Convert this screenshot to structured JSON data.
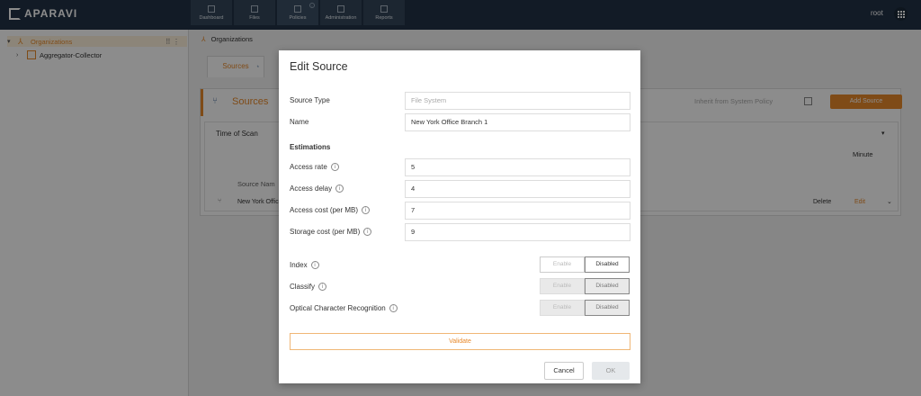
{
  "app": {
    "logo": "APARAVI",
    "user": "root"
  },
  "nav": [
    {
      "label": "Dashboard",
      "icon": "dashboard-icon"
    },
    {
      "label": "Files",
      "icon": "folder-icon"
    },
    {
      "label": "Policies",
      "icon": "gear-icon"
    },
    {
      "label": "Administration",
      "icon": "users-icon"
    },
    {
      "label": "Reports",
      "icon": "report-icon"
    }
  ],
  "sidebar": {
    "items": [
      {
        "label": "Organizations"
      },
      {
        "label": "Aggregator-Collector"
      }
    ]
  },
  "breadcrumb": {
    "label": "Organizations"
  },
  "tab": {
    "label": "Sources",
    "marker": "*"
  },
  "panel": {
    "title": "Sources",
    "inherit_label": "Inherit from System Policy",
    "add_label": "Add Source",
    "time_of_scan": "Time of Scan",
    "minute": "Minute",
    "column_header": "Source Nam",
    "row": {
      "name": "New York Offic",
      "delete": "Delete",
      "edit": "Edit"
    }
  },
  "modal": {
    "title": "Edit Source",
    "source_type_label": "Source Type",
    "source_type_value": "File System",
    "name_label": "Name",
    "name_value": "New York Office Branch 1",
    "estimations_label": "Estimations",
    "access_rate_label": "Access rate",
    "access_rate_value": "5",
    "access_delay_label": "Access delay",
    "access_delay_value": "4",
    "access_cost_label": "Access cost (per MB)",
    "access_cost_value": "7",
    "storage_cost_label": "Storage cost (per MB)",
    "storage_cost_value": "9",
    "index_label": "Index",
    "classify_label": "Classify",
    "ocr_label": "Optical Character Recognition",
    "enable_label": "Enable",
    "disabled_label": "Disabled",
    "validate_label": "Validate",
    "cancel_label": "Cancel",
    "ok_label": "OK"
  },
  "colors": {
    "accent": "#e8892b",
    "topbar": "#223246"
  }
}
